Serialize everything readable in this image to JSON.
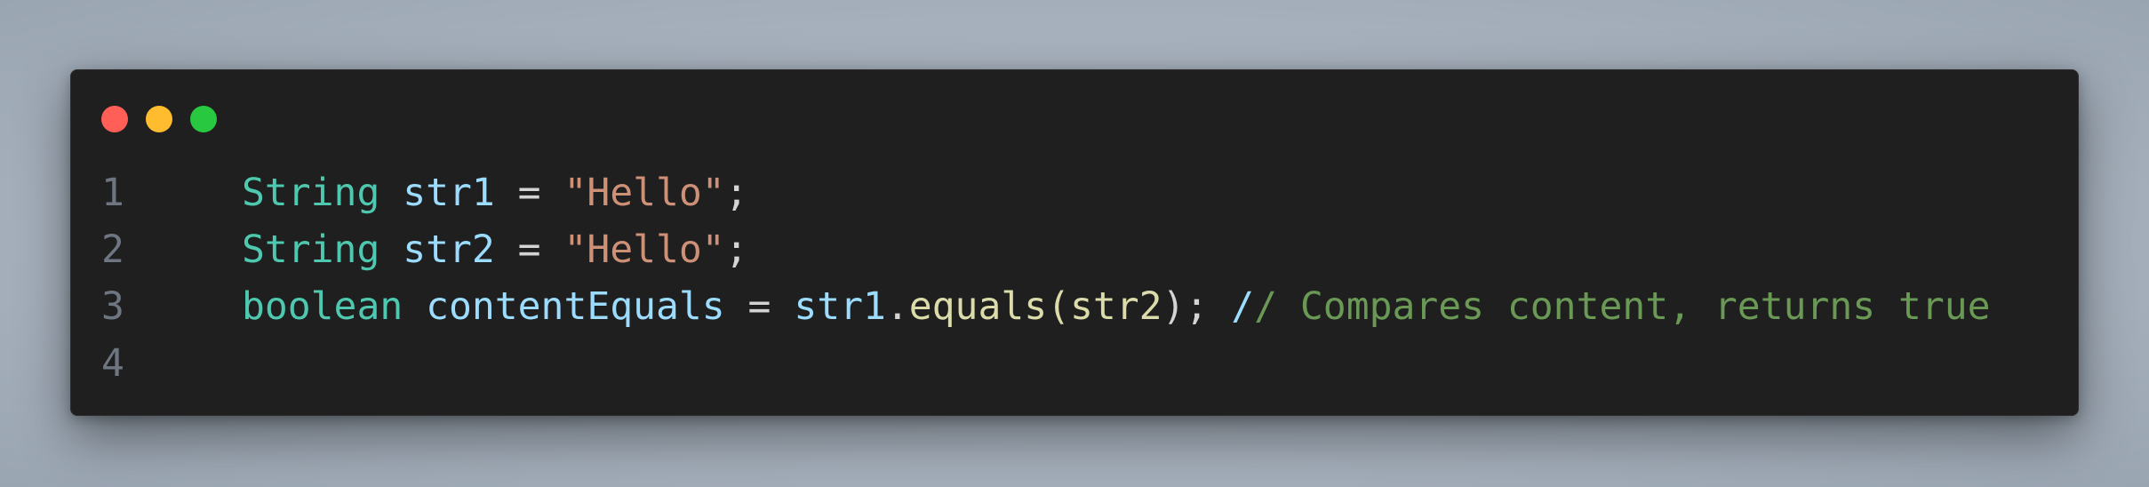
{
  "window": {
    "controls": [
      {
        "name": "close",
        "color": "#ff5f57"
      },
      {
        "name": "minimize",
        "color": "#febc2e"
      },
      {
        "name": "maximize",
        "color": "#28c840"
      }
    ]
  },
  "code": {
    "lines": [
      {
        "number": "1",
        "tokens": [
          {
            "text": "String",
            "kind": "type"
          },
          {
            "text": " ",
            "kind": "op"
          },
          {
            "text": "str1",
            "kind": "var"
          },
          {
            "text": " = ",
            "kind": "op"
          },
          {
            "text": "\"Hello\"",
            "kind": "str"
          },
          {
            "text": ";",
            "kind": "op"
          }
        ]
      },
      {
        "number": "2",
        "tokens": [
          {
            "text": "String",
            "kind": "type"
          },
          {
            "text": " ",
            "kind": "op"
          },
          {
            "text": "str2",
            "kind": "var"
          },
          {
            "text": " = ",
            "kind": "op"
          },
          {
            "text": "\"Hello\"",
            "kind": "str"
          },
          {
            "text": ";",
            "kind": "op"
          }
        ]
      },
      {
        "number": "3",
        "tokens": [
          {
            "text": "boolean",
            "kind": "type"
          },
          {
            "text": " ",
            "kind": "op"
          },
          {
            "text": "contentEquals",
            "kind": "var"
          },
          {
            "text": " = ",
            "kind": "op"
          },
          {
            "text": "str1",
            "kind": "var"
          },
          {
            "text": ".",
            "kind": "op"
          },
          {
            "text": "equals",
            "kind": "fn"
          },
          {
            "text": "(",
            "kind": "fn"
          },
          {
            "text": "str2",
            "kind": "fn"
          },
          {
            "text": ");",
            "kind": "op"
          },
          {
            "text": " ",
            "kind": "op"
          },
          {
            "text": "/",
            "kind": "var"
          },
          {
            "text": "/ Compares content, returns true",
            "kind": "com"
          }
        ]
      },
      {
        "number": "4",
        "tokens": []
      }
    ]
  }
}
